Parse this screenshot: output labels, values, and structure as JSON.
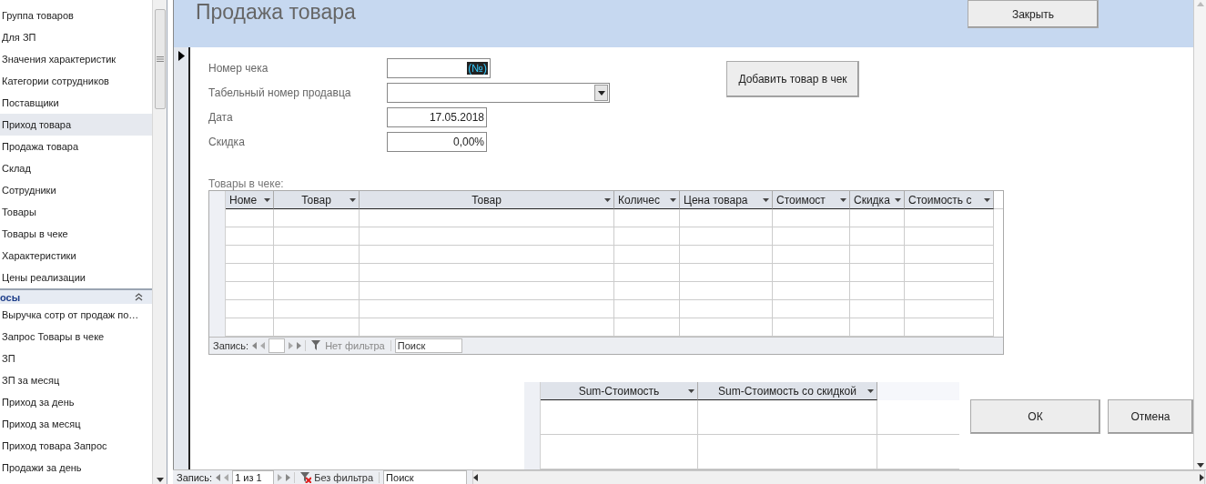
{
  "nav_pane": {
    "groups": [
      {
        "items": [
          {
            "label": "Группа товаров",
            "selected": false
          },
          {
            "label": "Для ЗП",
            "selected": false
          },
          {
            "label": "Значения характеристик",
            "selected": false
          },
          {
            "label": "Категории сотрудников",
            "selected": false
          },
          {
            "label": "Поставщики",
            "selected": false
          },
          {
            "label": "Приход товара",
            "selected": true
          },
          {
            "label": "Продажа товара",
            "selected": false
          },
          {
            "label": "Склад",
            "selected": false
          },
          {
            "label": "Сотрудники",
            "selected": false
          },
          {
            "label": "Товары",
            "selected": false
          },
          {
            "label": "Товары в чеке",
            "selected": false
          },
          {
            "label": "Характеристики",
            "selected": false
          },
          {
            "label": "Цены реализации",
            "selected": false
          }
        ]
      },
      {
        "header": "осы",
        "items": [
          {
            "label": "Выручка сотр от продаж по…",
            "selected": false
          },
          {
            "label": "Запрос Товары в чеке",
            "selected": false
          },
          {
            "label": "ЗП",
            "selected": false
          },
          {
            "label": "ЗП за месяц",
            "selected": false
          },
          {
            "label": "Приход за день",
            "selected": false
          },
          {
            "label": "Приход за месяц",
            "selected": false
          },
          {
            "label": "Приход товара Запрос",
            "selected": false
          },
          {
            "label": "Продажи за день",
            "selected": false
          }
        ]
      }
    ]
  },
  "form": {
    "title": "Продажа товара",
    "close_button": "Закрыть",
    "fields": [
      {
        "kind": "text",
        "label": "Номер чека",
        "value": "(№)",
        "highlighted": true
      },
      {
        "kind": "combo",
        "label": "Табельный номер продавца",
        "highlighted": false
      },
      {
        "kind": "text",
        "label": "Дата",
        "value": "17.05.2018",
        "highlighted": false
      },
      {
        "kind": "text",
        "label": "Скидка",
        "value": "0,00%",
        "highlighted": false
      }
    ],
    "add_button": "Добавить товар в чек",
    "subform_label": "Товары в чеке:",
    "items_grid": {
      "columns": [
        "Номе",
        "Товар",
        "Товар",
        "Количес",
        "Цена товара",
        "Стоимост",
        "Скидка",
        "Стоимость с"
      ],
      "nav": {
        "label": "Запись:",
        "filter": "Нет фильтра",
        "filter_active": false,
        "search": "Поиск"
      }
    },
    "sum_grid": {
      "columns": [
        "Sum-Стоимость",
        "Sum-Стоимость со скидкой"
      ]
    },
    "buttons": [
      "ОК",
      "Отмена"
    ]
  },
  "record_nav": {
    "label": "Запись:",
    "position": "1 из 1",
    "filter": "Без фильтра",
    "filter_active": true,
    "search": "Поиск"
  }
}
